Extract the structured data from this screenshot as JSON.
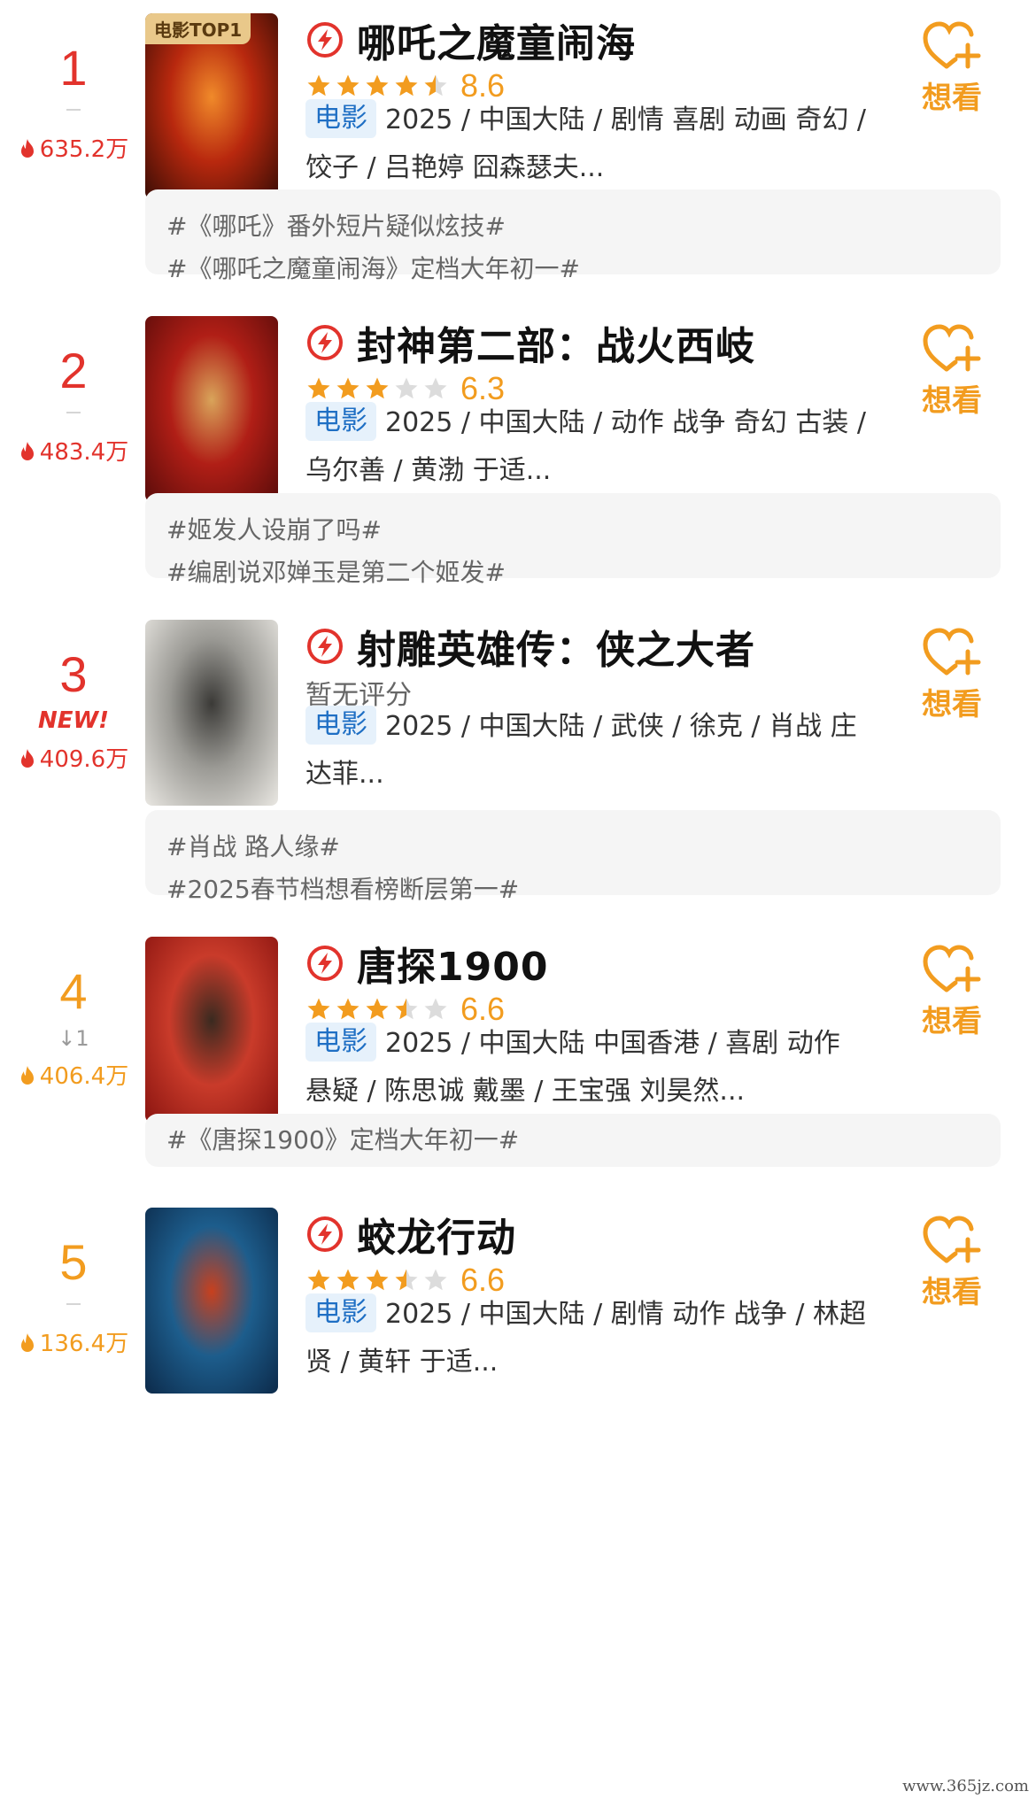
{
  "entries": [
    {
      "rank": "1",
      "rank_color": "red",
      "change": "",
      "is_new": false,
      "new_label": "",
      "heat": "635.2万",
      "poster_badge": "电影TOP1",
      "poster_colors": [
        "#3a0d05",
        "#b8280e",
        "#f08a2a"
      ],
      "title": "哪吒之魔童闹海",
      "stars": 4.5,
      "score": "8.6",
      "no_score_text": "",
      "type_tag": "电影",
      "meta_line1": "2025 / 中国大陆 / 剧情 喜剧 动画 奇幻 /",
      "meta_line2": "饺子 / 吕艳婷 囧森瑟夫...",
      "want_label": "想看",
      "topics": [
        "#《哪吒》番外短片疑似炫技#",
        "#《哪吒之魔童闹海》定档大年初一#"
      ]
    },
    {
      "rank": "2",
      "rank_color": "red",
      "change": "",
      "is_new": false,
      "new_label": "",
      "heat": "483.4万",
      "poster_badge": "",
      "poster_colors": [
        "#5a0c0a",
        "#b01e16",
        "#d9a45a"
      ],
      "title": "封神第二部：战火西岐",
      "stars": 3,
      "score": "6.3",
      "no_score_text": "",
      "type_tag": "电影",
      "meta_line1": "2025 / 中国大陆 / 动作 战争 奇幻 古装 /",
      "meta_line2": "乌尔善 / 黄渤 于适...",
      "want_label": "想看",
      "topics": [
        "#姬发人设崩了吗#",
        "#编剧说邓婵玉是第二个姬发#"
      ]
    },
    {
      "rank": "3",
      "rank_color": "red",
      "change": "",
      "is_new": true,
      "new_label": "NEW!",
      "heat": "409.6万",
      "poster_badge": "",
      "poster_colors": [
        "#e9e7e2",
        "#9b9a95",
        "#3b3a37"
      ],
      "title": "射雕英雄传：侠之大者",
      "stars": 0,
      "score": "",
      "no_score_text": "暂无评分",
      "type_tag": "电影",
      "meta_line1": "2025 / 中国大陆 / 武侠 / 徐克 / 肖战 庄",
      "meta_line2": "达菲...",
      "want_label": "想看",
      "topics": [
        "#肖战 路人缘#",
        "#2025春节档想看榜断层第一#"
      ]
    },
    {
      "rank": "4",
      "rank_color": "orange",
      "change": "↓1",
      "is_new": false,
      "new_label": "",
      "heat": "406.4万",
      "poster_badge": "",
      "poster_colors": [
        "#8a1410",
        "#c93b2a",
        "#3a2a20"
      ],
      "title": "唐探1900",
      "stars": 3.5,
      "score": "6.6",
      "no_score_text": "",
      "type_tag": "电影",
      "meta_line1": "2025 / 中国大陆 中国香港 / 喜剧 动作",
      "meta_line2": "悬疑 / 陈思诚 戴墨 / 王宝强 刘昊然...",
      "want_label": "想看",
      "topics": [
        "#《唐探1900》定档大年初一#"
      ]
    },
    {
      "rank": "5",
      "rank_color": "orange",
      "change": "",
      "is_new": false,
      "new_label": "",
      "heat": "136.4万",
      "poster_badge": "",
      "poster_colors": [
        "#0c2a4a",
        "#1d5d8c",
        "#c8401e"
      ],
      "title": "蛟龙行动",
      "stars": 3.5,
      "score": "6.6",
      "no_score_text": "",
      "type_tag": "电影",
      "meta_line1": "2025 / 中国大陆 / 剧情 动作 战争 / 林超",
      "meta_line2": "贤 / 黄轩 于适...",
      "want_label": "想看",
      "topics": []
    }
  ],
  "watermark": "www.365jz.com",
  "colors": {
    "rank_red": "#e2332c",
    "rank_orange": "#f29c1f",
    "star": "#f29c1f",
    "tag_bg": "#e6f1fb",
    "tag_text": "#1f6fc4"
  },
  "icons": {
    "hot": "play-lightning-icon",
    "flame": "flame-icon",
    "want": "heart-plus-icon",
    "star": "star-icon"
  }
}
